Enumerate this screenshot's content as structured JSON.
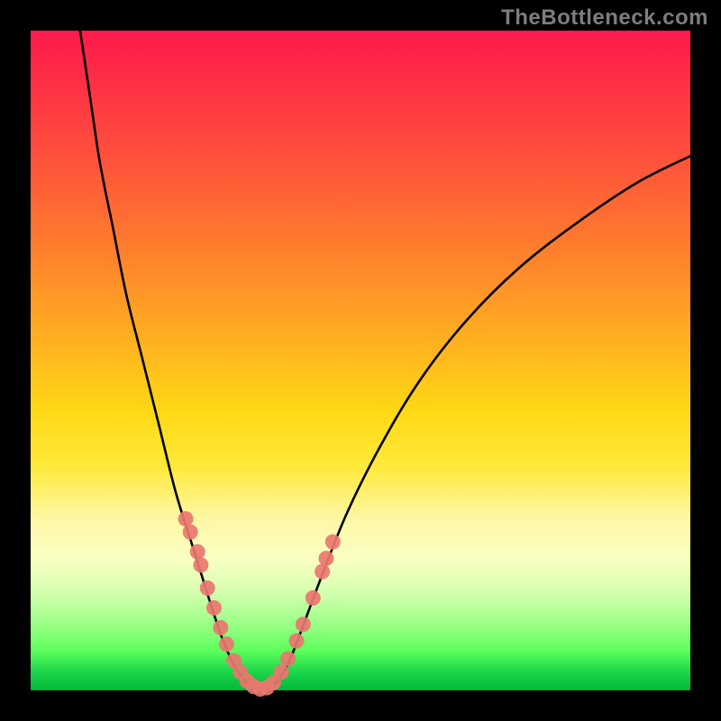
{
  "watermark": "TheBottleneck.com",
  "colors": {
    "curve": "#000000",
    "marker_fill": "#e9776f",
    "marker_stroke": "#e9776f"
  },
  "chart_data": {
    "type": "line",
    "title": "",
    "xlabel": "",
    "ylabel": "",
    "xlim": [
      0,
      100
    ],
    "ylim": [
      0,
      100
    ],
    "curve": [
      {
        "x": 7.5,
        "y": 100.0
      },
      {
        "x": 9.0,
        "y": 90.0
      },
      {
        "x": 10.5,
        "y": 80.0
      },
      {
        "x": 12.5,
        "y": 70.0
      },
      {
        "x": 14.5,
        "y": 60.0
      },
      {
        "x": 17.0,
        "y": 50.0
      },
      {
        "x": 19.5,
        "y": 40.0
      },
      {
        "x": 22.0,
        "y": 30.0
      },
      {
        "x": 24.5,
        "y": 22.0
      },
      {
        "x": 27.0,
        "y": 14.0
      },
      {
        "x": 29.0,
        "y": 8.0
      },
      {
        "x": 31.0,
        "y": 3.5
      },
      {
        "x": 33.0,
        "y": 1.0
      },
      {
        "x": 35.0,
        "y": 0.0
      },
      {
        "x": 37.0,
        "y": 1.0
      },
      {
        "x": 39.0,
        "y": 4.0
      },
      {
        "x": 41.0,
        "y": 9.0
      },
      {
        "x": 44.0,
        "y": 17.0
      },
      {
        "x": 48.0,
        "y": 27.0
      },
      {
        "x": 53.0,
        "y": 37.0
      },
      {
        "x": 59.0,
        "y": 47.0
      },
      {
        "x": 66.0,
        "y": 56.0
      },
      {
        "x": 74.0,
        "y": 64.0
      },
      {
        "x": 83.0,
        "y": 71.0
      },
      {
        "x": 92.0,
        "y": 77.0
      },
      {
        "x": 100.0,
        "y": 81.0
      }
    ],
    "markers": [
      {
        "x": 23.5,
        "y": 26.0
      },
      {
        "x": 24.2,
        "y": 24.0
      },
      {
        "x": 25.3,
        "y": 21.0
      },
      {
        "x": 25.8,
        "y": 19.0
      },
      {
        "x": 26.8,
        "y": 15.5
      },
      {
        "x": 27.8,
        "y": 12.5
      },
      {
        "x": 28.8,
        "y": 9.5
      },
      {
        "x": 29.7,
        "y": 7.0
      },
      {
        "x": 30.8,
        "y": 4.5
      },
      {
        "x": 31.8,
        "y": 2.8
      },
      {
        "x": 32.8,
        "y": 1.4
      },
      {
        "x": 33.8,
        "y": 0.6
      },
      {
        "x": 34.8,
        "y": 0.2
      },
      {
        "x": 35.8,
        "y": 0.4
      },
      {
        "x": 36.8,
        "y": 1.2
      },
      {
        "x": 38.0,
        "y": 2.8
      },
      {
        "x": 39.0,
        "y": 4.8
      },
      {
        "x": 40.3,
        "y": 7.5
      },
      {
        "x": 41.3,
        "y": 10.0
      },
      {
        "x": 42.8,
        "y": 14.0
      },
      {
        "x": 44.2,
        "y": 18.0
      },
      {
        "x": 44.8,
        "y": 20.0
      },
      {
        "x": 45.8,
        "y": 22.5
      }
    ]
  }
}
